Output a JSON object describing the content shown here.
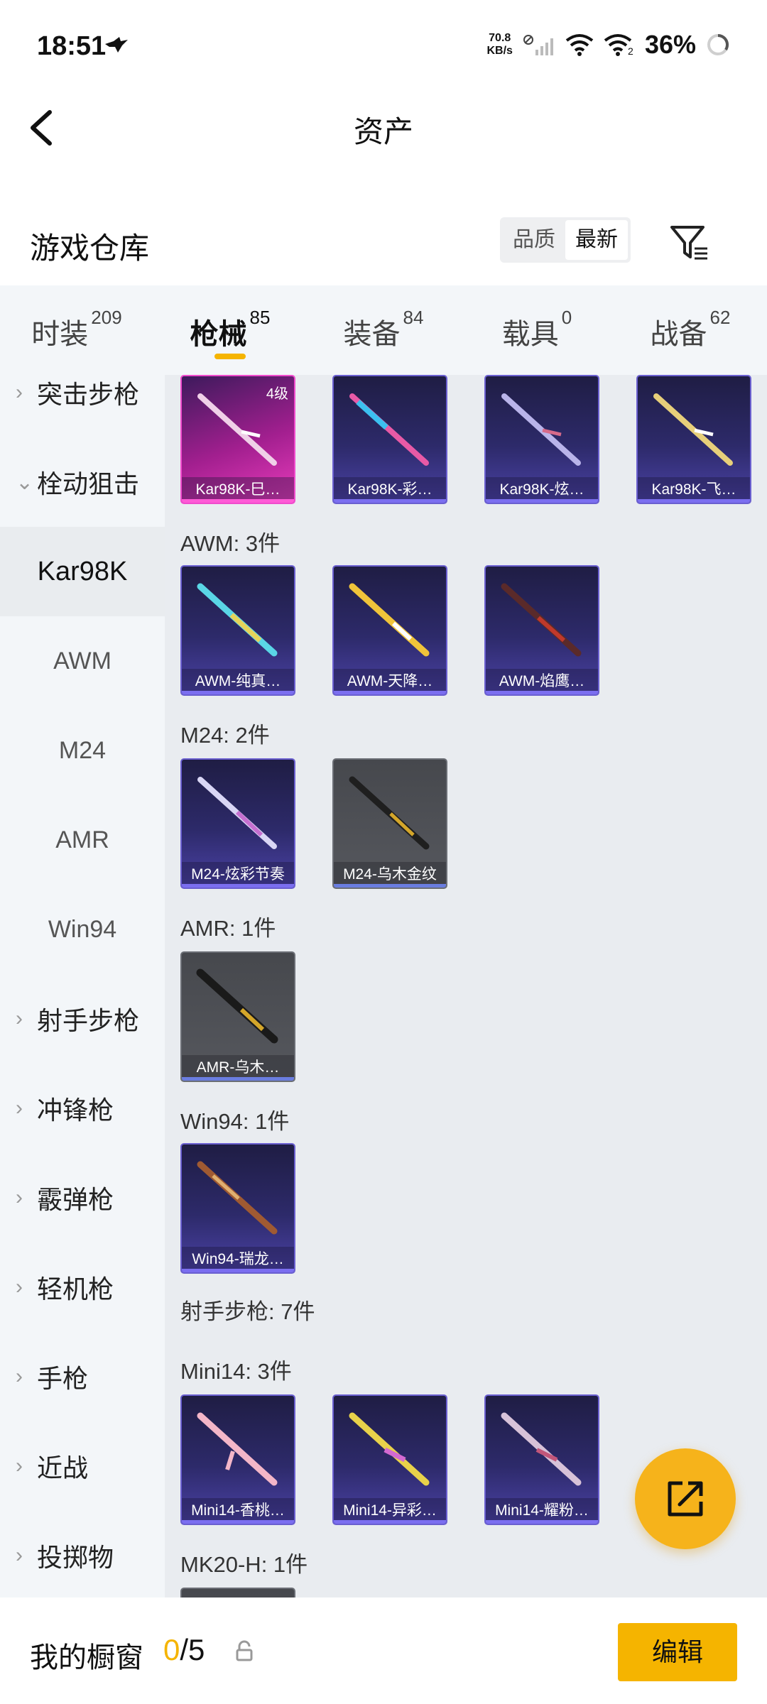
{
  "status_bar": {
    "time": "18:51",
    "net_speed_value": "70.8",
    "net_speed_unit": "KB/s",
    "battery": "36%"
  },
  "header": {
    "title": "资产"
  },
  "warehouse": {
    "title": "游戏仓库",
    "sort_quality": "品质",
    "sort_latest": "最新"
  },
  "tabs": [
    {
      "label": "时装",
      "count": "209"
    },
    {
      "label": "枪械",
      "count": "85"
    },
    {
      "label": "装备",
      "count": "84"
    },
    {
      "label": "载具",
      "count": "0"
    },
    {
      "label": "战备",
      "count": "62"
    }
  ],
  "sidebar": {
    "items": [
      {
        "label": "突击步枪"
      },
      {
        "label": "栓动狙击"
      },
      {
        "label": "Kar98K"
      },
      {
        "label": "AWM"
      },
      {
        "label": "M24"
      },
      {
        "label": "AMR"
      },
      {
        "label": "Win94"
      },
      {
        "label": "射手步枪"
      },
      {
        "label": "冲锋枪"
      },
      {
        "label": "霰弹枪"
      },
      {
        "label": "轻机枪"
      },
      {
        "label": "手枪"
      },
      {
        "label": "近战"
      },
      {
        "label": "投掷物"
      }
    ]
  },
  "sections": {
    "kar98k_cards": [
      {
        "name": "Kar98K-巳…",
        "level": "4级",
        "rarity": "pink"
      },
      {
        "name": "Kar98K-彩…",
        "rarity": "purple"
      },
      {
        "name": "Kar98K-炫…",
        "rarity": "purple"
      },
      {
        "name": "Kar98K-飞…",
        "rarity": "purple"
      }
    ],
    "awm_label": "AWM: 3件",
    "awm_cards": [
      {
        "name": "AWM-纯真…"
      },
      {
        "name": "AWM-天降…"
      },
      {
        "name": "AWM-焰鹰…"
      }
    ],
    "m24_label": "M24: 2件",
    "m24_cards": [
      {
        "name": "M24-炫彩节奏"
      },
      {
        "name": "M24-乌木金纹"
      }
    ],
    "amr_label": "AMR: 1件",
    "amr_cards": [
      {
        "name": "AMR-乌木…"
      }
    ],
    "win94_label": "Win94: 1件",
    "win94_cards": [
      {
        "name": "Win94-瑞龙…"
      }
    ],
    "dmr_label": "射手步枪: 7件",
    "mini14_label": "Mini14: 3件",
    "mini14_cards": [
      {
        "name": "Mini14-香桃…"
      },
      {
        "name": "Mini14-异彩…"
      },
      {
        "name": "Mini14-耀粉…"
      }
    ],
    "mk20_label": "MK20-H: 1件"
  },
  "showcase": {
    "title": "我的橱窗",
    "used": "0",
    "separator": "/",
    "total": "5",
    "edit_label": "编辑"
  },
  "colors": {
    "accent": "#f5b400",
    "fab": "#f6b31b"
  }
}
